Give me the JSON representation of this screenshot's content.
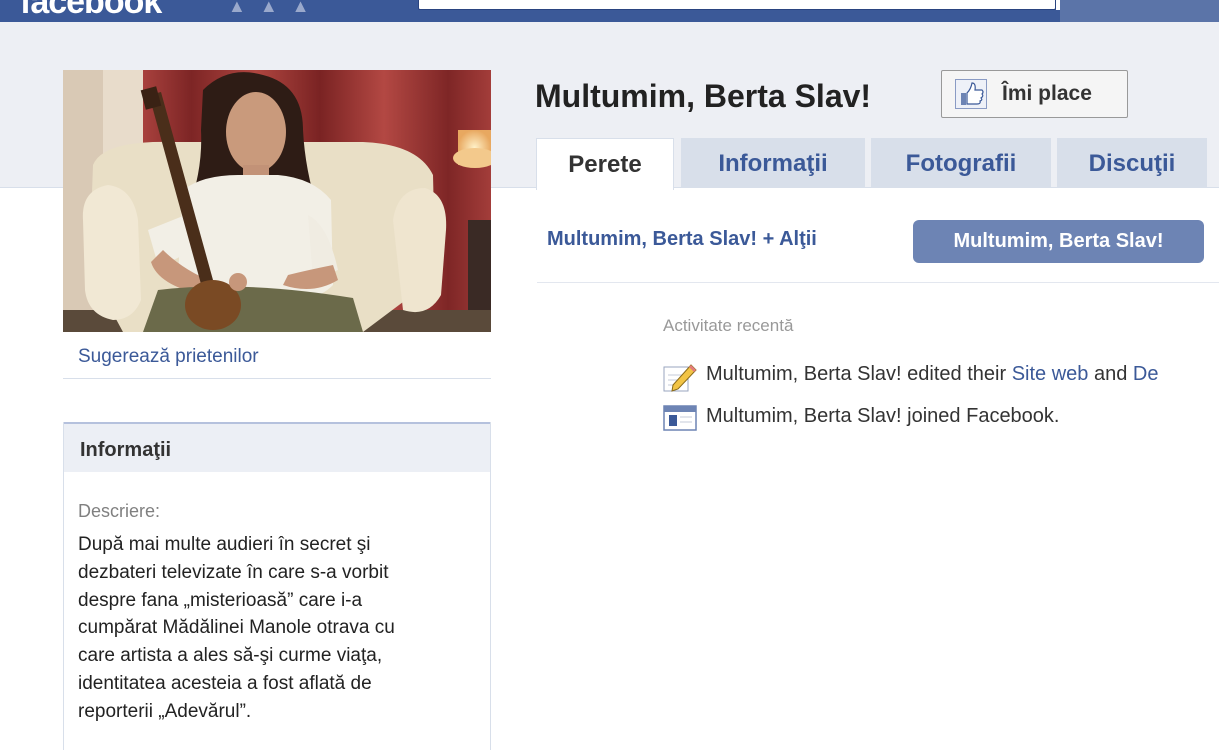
{
  "topbar": {
    "logo": "facebook",
    "nav_icons": [
      "friends-icon",
      "messages-icon",
      "notifications-icon"
    ]
  },
  "left": {
    "suggest_link": "Sugerează prietenilor",
    "info_title": "Informaţii",
    "description_label": "Descriere:",
    "description_lines": [
      "După mai multe audieri în secret şi",
      "dezbateri televizate în care s-a vorbit",
      "despre fana „misterioasă” care i-a",
      "cumpărat Mădălinei Manole otrava cu",
      "care artista a ales să-şi curme viaţa,",
      "identitatea acesteia a fost aflată de",
      "reporterii „Adevărul”."
    ]
  },
  "header": {
    "title": "Multumim, Berta Slav!",
    "like_label": "Îmi place"
  },
  "tabs": [
    {
      "label": "Perete"
    },
    {
      "label": "Informaţii"
    },
    {
      "label": "Fotografii"
    },
    {
      "label": "Discuţii"
    }
  ],
  "filters": {
    "all": "Multumim, Berta Slav! + Alţii",
    "page_only": "Multumim, Berta Slav!"
  },
  "recent": {
    "title": "Activitate recentă",
    "items": [
      {
        "prefix": "Multumim, Berta Slav! edited their ",
        "link1": "Site web",
        "middle": " and ",
        "link2": "De",
        "icon": "pencil-icon"
      },
      {
        "text": "Multumim, Berta Slav! joined Facebook.",
        "icon": "facebook-page-icon"
      }
    ]
  },
  "colors": {
    "brand_blue": "#3b5998",
    "header_band": "#edeff4",
    "selected_filter": "#6d84b4"
  }
}
